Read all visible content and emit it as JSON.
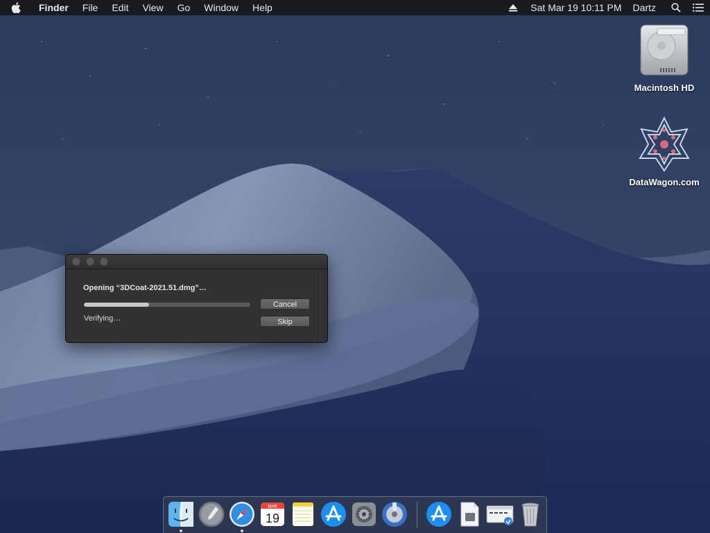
{
  "menubar": {
    "app_name": "Finder",
    "items": [
      "File",
      "Edit",
      "View",
      "Go",
      "Window",
      "Help"
    ],
    "clock": "Sat Mar 19  10:11 PM",
    "user": "Dartz"
  },
  "desktop": {
    "icons": [
      {
        "label": "Macintosh HD",
        "icon": "hard-drive-icon"
      },
      {
        "label": "DataWagon.com",
        "icon": "star-mandala-icon"
      }
    ]
  },
  "dialog": {
    "message": "Opening “3DCoat-2021.51.dmg”…",
    "status": "Verifying…",
    "progress": 0.39,
    "cancel_label": "Cancel",
    "skip_label": "Skip"
  },
  "dock": {
    "calendar_month": "MAR",
    "calendar_day": "19",
    "items": [
      "finder-icon",
      "launchpad-icon",
      "safari-icon",
      "calendar-icon",
      "notes-icon",
      "app-store-icon",
      "system-preferences-icon",
      "disk-utility-icon",
      "app-store-icon",
      "document-icon",
      "dmg-window-icon",
      "trash-icon"
    ]
  },
  "colors": {
    "menubar_bg": "#19191c",
    "dialog_bg": "#323233",
    "progress_fill": "#c8c8c9",
    "desktop_blue": "#1f2c4a"
  }
}
